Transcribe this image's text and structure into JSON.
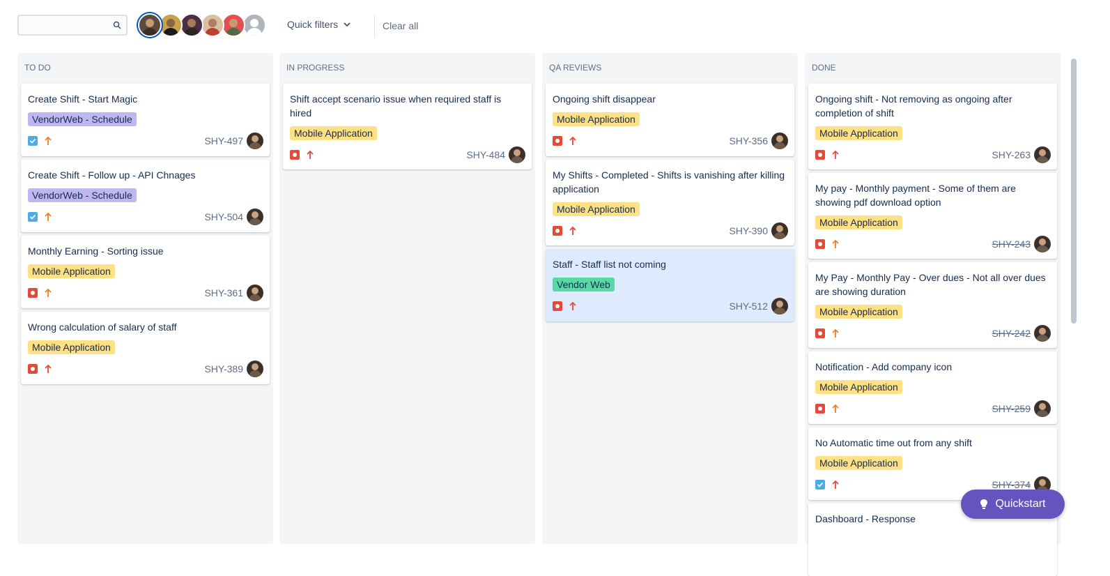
{
  "toolbar": {
    "search": {
      "value": "",
      "placeholder": ""
    },
    "quick_filters_label": "Quick filters",
    "clear_all_label": "Clear all"
  },
  "avatars": [
    {
      "face": "#c29b76",
      "body": "#3a2e27",
      "bg": "#5a4b3f",
      "selected": true
    },
    {
      "face": "#8a6245",
      "body": "#1b1b1b",
      "bg": "#c9a14a",
      "selected": false
    },
    {
      "face": "#a77a5a",
      "body": "#2d2523",
      "bg": "#4d2f45",
      "selected": false
    },
    {
      "face": "#b07d62",
      "body": "#c04030",
      "bg": "#d8c0a0",
      "selected": false
    },
    {
      "face": "#c79a72",
      "body": "#4f6b48",
      "bg": "#e05050",
      "selected": false
    },
    {
      "face": "#ffffff",
      "body": "#ffffff",
      "bg": "#b0b4bc",
      "selected": false
    }
  ],
  "colors": {
    "epic_vendorweb_schedule": "#c0b6f2",
    "epic_mobile_application": "#fee085",
    "epic_vendor_web": "#57d9a3",
    "type_task": "#4bade8",
    "type_bug": "#e5493a",
    "prio_high": "#e5493a",
    "prio_medium": "#f17d26"
  },
  "columns": [
    {
      "title": "TO DO",
      "cards": [
        {
          "title": "Create Shift - Start Magic",
          "epic": "VendorWeb - Schedule",
          "epic_color": "#c0b6f2",
          "type": "task",
          "priority": "medium",
          "key": "SHY-497",
          "done": false
        },
        {
          "title": "Create Shift - Follow up - API Chnages",
          "epic": "VendorWeb - Schedule",
          "epic_color": "#c0b6f2",
          "type": "task",
          "priority": "medium",
          "key": "SHY-504",
          "done": false
        },
        {
          "title": "Monthly Earning - Sorting issue",
          "epic": "Mobile Application",
          "epic_color": "#fee085",
          "type": "bug",
          "priority": "medium",
          "key": "SHY-361",
          "done": false
        },
        {
          "title": "Wrong calculation of salary of staff",
          "epic": "Mobile Application",
          "epic_color": "#fee085",
          "type": "bug",
          "priority": "high",
          "key": "SHY-389",
          "done": false
        }
      ]
    },
    {
      "title": "IN PROGRESS",
      "cards": [
        {
          "title": "Shift accept scenario issue when required staff is hired",
          "epic": "Mobile Application",
          "epic_color": "#fee085",
          "type": "bug",
          "priority": "high",
          "key": "SHY-484",
          "done": false
        }
      ]
    },
    {
      "title": "QA REVIEWS",
      "cards": [
        {
          "title": "Ongoing shift disappear",
          "epic": "Mobile Application",
          "epic_color": "#fee085",
          "type": "bug",
          "priority": "high",
          "key": "SHY-356",
          "done": false
        },
        {
          "title": "My Shifts - Completed - Shifts is vanishing after killing application",
          "epic": "Mobile Application",
          "epic_color": "#fee085",
          "type": "bug",
          "priority": "high",
          "key": "SHY-390",
          "done": false
        },
        {
          "title": "Staff - Staff list not coming",
          "epic": "Vendor Web",
          "epic_color": "#57d9a3",
          "type": "bug",
          "priority": "high",
          "key": "SHY-512",
          "done": false,
          "highlight": true
        }
      ]
    },
    {
      "title": "DONE",
      "cards": [
        {
          "title": "Ongoing shift - Not removing as ongoing after completion of shift",
          "epic": "Mobile Application",
          "epic_color": "#fee085",
          "type": "bug",
          "priority": "high",
          "key": "SHY-263",
          "done": false
        },
        {
          "title": "My pay - Monthly payment - Some of them are showing pdf download option",
          "epic": "Mobile Application",
          "epic_color": "#fee085",
          "type": "bug",
          "priority": "medium",
          "key": "SHY-243",
          "done": true
        },
        {
          "title": "My Pay - Monthly Pay - Over dues - Not all over dues are showing duration",
          "epic": "Mobile Application",
          "epic_color": "#fee085",
          "type": "bug",
          "priority": "medium",
          "key": "SHY-242",
          "done": true
        },
        {
          "title": "Notification - Add company icon",
          "epic": "Mobile Application",
          "epic_color": "#fee085",
          "type": "bug",
          "priority": "medium",
          "key": "SHY-259",
          "done": true
        },
        {
          "title": "No Automatic time out from any shift",
          "epic": "Mobile Application",
          "epic_color": "#fee085",
          "type": "task",
          "priority": "high",
          "key": "SHY-374",
          "done": true
        },
        {
          "title": "Dashboard - Response",
          "epic": "",
          "epic_color": "#fee085",
          "type": "",
          "priority": "",
          "key": "",
          "done": false
        }
      ]
    }
  ],
  "quickstart_label": "Quickstart"
}
